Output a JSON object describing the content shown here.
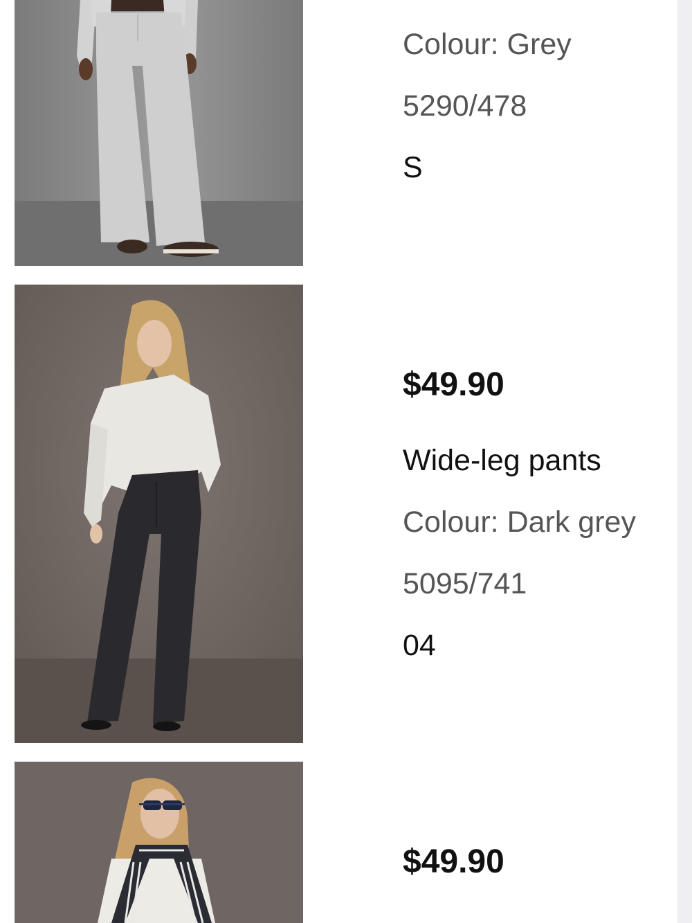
{
  "products": [
    {
      "colour": "Colour: Grey",
      "article": "5290/478",
      "size": "S",
      "image": "model-in-grey-knit-wide-leg-pants"
    },
    {
      "price": "$49.90",
      "name": "Wide-leg pants",
      "colour": "Colour: Dark grey",
      "article": "5095/741",
      "size": "04",
      "image": "model-in-white-sweater-and-dark-grey-wide-leg-pants"
    },
    {
      "price": "$49.90",
      "image": "model-with-sunglasses-and-striped-scarf"
    }
  ],
  "colors": {
    "page_background": "#ffffff",
    "outer_background": "#efeff1",
    "price_text": "#111111",
    "secondary_text": "#555555"
  }
}
